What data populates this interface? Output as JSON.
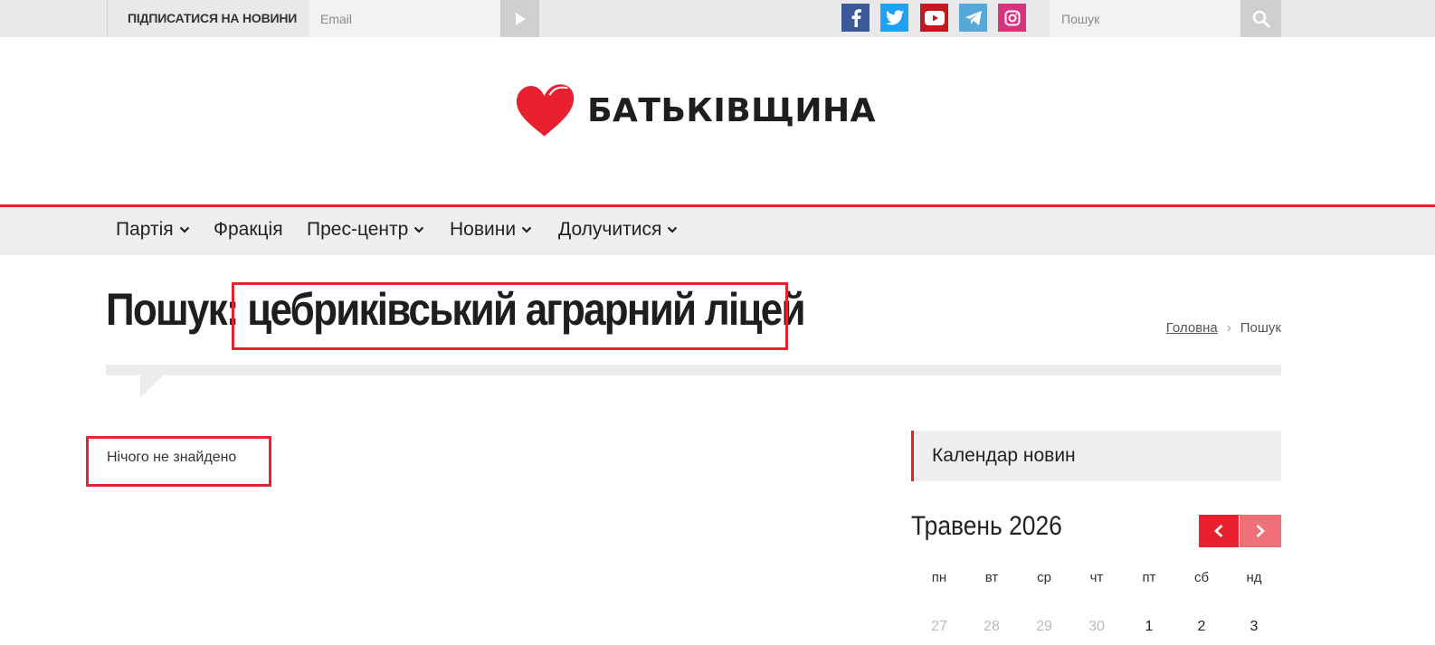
{
  "topbar": {
    "subscribe_label": "ПІДПИСАТИСЯ НА НОВИНИ",
    "email_placeholder": "Email",
    "search_placeholder": "Пошук",
    "social": [
      {
        "name": "facebook-icon",
        "color": "#3b5998",
        "glyph": "f"
      },
      {
        "name": "twitter-icon",
        "color": "#1da1f2",
        "glyph": "t"
      },
      {
        "name": "youtube-icon",
        "color": "#c4181e",
        "glyph": "y"
      },
      {
        "name": "telegram-icon",
        "color": "#55a8d9",
        "glyph": "tg"
      },
      {
        "name": "instagram-icon",
        "color": "#d8337f",
        "glyph": "ig"
      }
    ]
  },
  "logo": {
    "text": "БАТЬКІВЩИНА",
    "heart_color": "#e8202f"
  },
  "nav": {
    "items": [
      {
        "label": "Партія",
        "dropdown": true
      },
      {
        "label": "Фракція",
        "dropdown": false
      },
      {
        "label": "Прес-центр",
        "dropdown": true
      },
      {
        "label": "Новини",
        "dropdown": true
      },
      {
        "label": "Долучитися",
        "dropdown": true
      }
    ]
  },
  "search_page": {
    "title_prefix": "Пошук:",
    "query": "цебриківський аграрний ліцей",
    "not_found": "Нічого не знайдено"
  },
  "breadcrumb": {
    "home": "Головна",
    "current": "Пошук"
  },
  "calendar": {
    "widget_title": "Календар новин",
    "month": "Травень 2026",
    "weekdays": [
      "пн",
      "вт",
      "ср",
      "чт",
      "пт",
      "сб",
      "нд"
    ],
    "first_week": [
      {
        "day": "27",
        "muted": true
      },
      {
        "day": "28",
        "muted": true
      },
      {
        "day": "29",
        "muted": true
      },
      {
        "day": "30",
        "muted": true
      },
      {
        "day": "1",
        "muted": false
      },
      {
        "day": "2",
        "muted": false
      },
      {
        "day": "3",
        "muted": false
      }
    ]
  },
  "colors": {
    "accent": "#e8202f",
    "accent_light": "#f07079",
    "bar_bg": "#e9e9e9"
  }
}
